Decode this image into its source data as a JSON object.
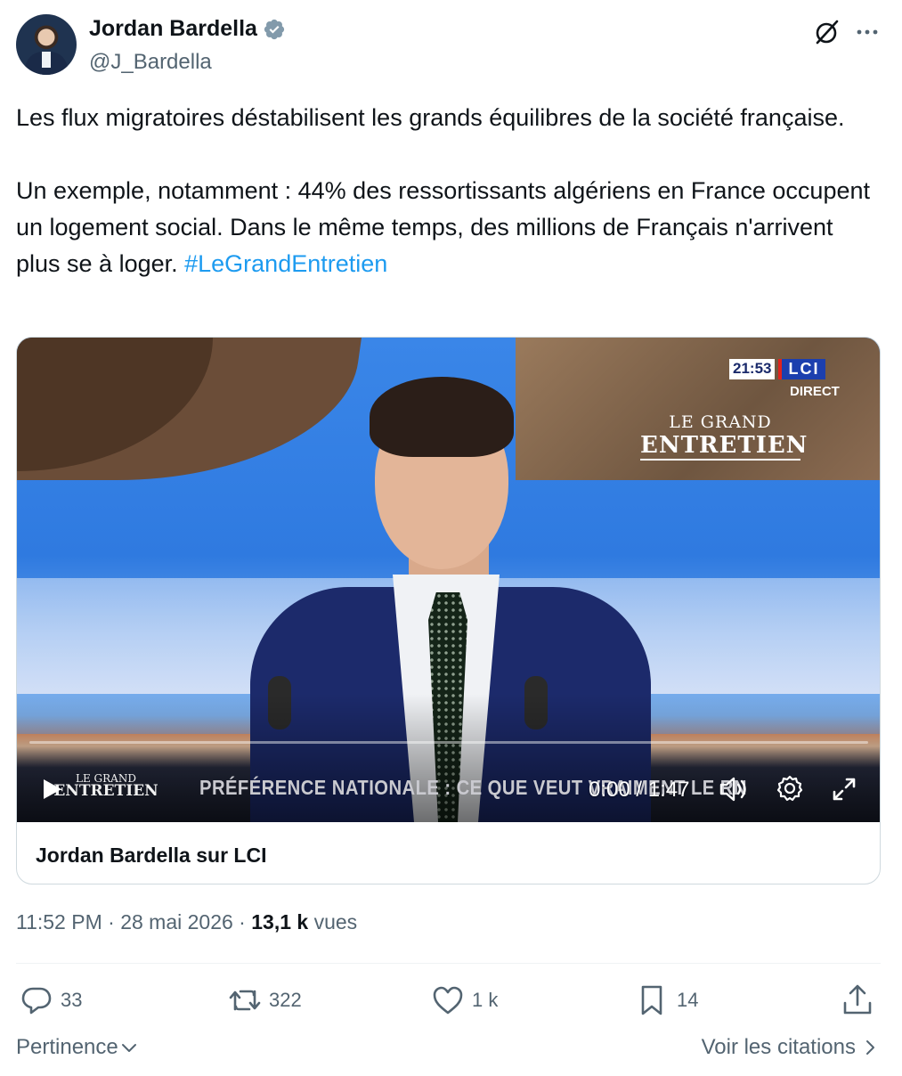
{
  "author": {
    "display_name": "Jordan Bardella",
    "handle": "@J_Bardella",
    "verified": true
  },
  "tweet": {
    "text_main": "Les flux migratoires déstabilisent les grands équilibres de la société française.\n\nUn exemple, notamment : 44% des ressortissants algériens en France occupent un logement social. Dans le même temps, des millions de Français n'arrivent plus se à loger. ",
    "hashtag": "#LeGrandEntretien"
  },
  "video": {
    "channel_time": "21:53",
    "channel_name": "LCI",
    "channel_status": "DIRECT",
    "show_logo_small": "LE GRAND",
    "show_logo_big": "ENTRETIEN",
    "ticker_text": "PRÉFÉRENCE NATIONALE : CE QUE VEUT VRAIMENT LE RN",
    "time_display": "0:00 / 1:47",
    "progress": 0
  },
  "card": {
    "title": "Jordan Bardella sur LCI"
  },
  "meta": {
    "time": "11:52 PM",
    "separator": " · ",
    "date": "28 mai 2026",
    "views_count": "13,1 k",
    "views_label": " vues"
  },
  "actions": {
    "replies": "33",
    "reposts": "322",
    "likes": "1 k",
    "bookmarks": "14"
  },
  "footer": {
    "sort_label": "Pertinence",
    "quotes_label": "Voir les citations"
  },
  "colors": {
    "link": "#1d9bf0",
    "verified": "#829aab",
    "secondary_text": "#536471",
    "primary_text": "#0f1419"
  }
}
